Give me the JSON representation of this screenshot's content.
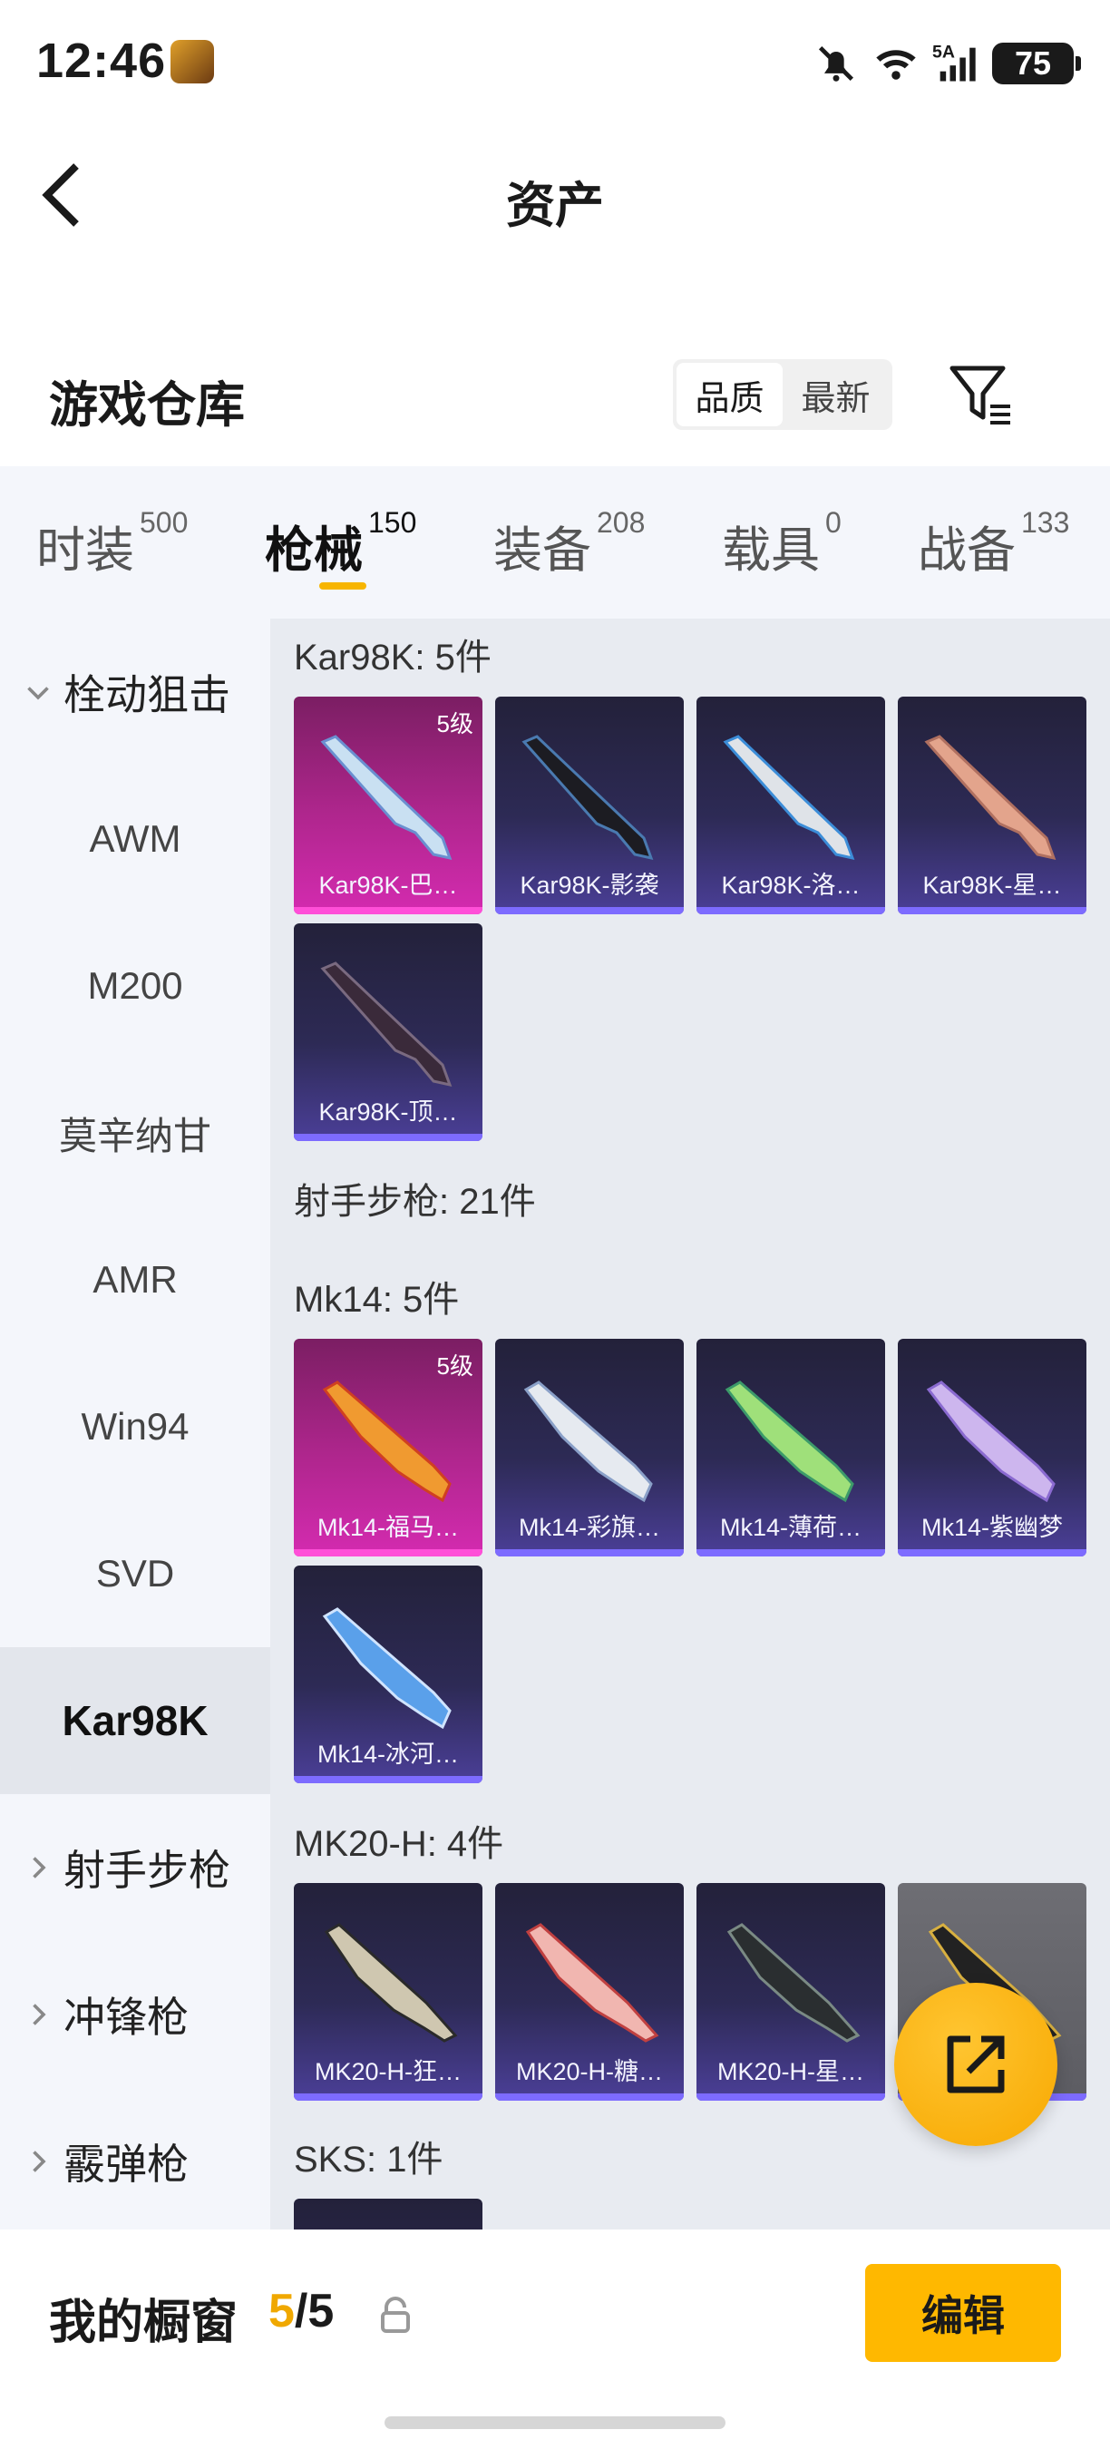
{
  "status_bar": {
    "time": "12:46",
    "network": "5A",
    "battery": "75"
  },
  "header": {
    "title": "资产"
  },
  "warehouse": {
    "title": "游戏仓库",
    "sort_options": [
      {
        "label": "品质",
        "active": true
      },
      {
        "label": "最新",
        "active": false
      }
    ]
  },
  "tabs": [
    {
      "label": "时装",
      "count": "500",
      "active": false
    },
    {
      "label": "枪械",
      "count": "150",
      "active": true
    },
    {
      "label": "装备",
      "count": "208",
      "active": false
    },
    {
      "label": "载具",
      "count": "0",
      "active": false
    },
    {
      "label": "战备",
      "count": "133",
      "active": false
    }
  ],
  "sidebar": {
    "groups": [
      {
        "label": "栓动狙击",
        "expanded": true
      },
      {
        "label": "射手步枪",
        "expanded": false
      },
      {
        "label": "冲锋枪",
        "expanded": false
      },
      {
        "label": "霰弹枪",
        "expanded": false
      }
    ],
    "items": [
      "AWM",
      "M200",
      "莫辛纳甘",
      "AMR",
      "Win94",
      "SVD",
      "Kar98K"
    ],
    "selected": "Kar98K"
  },
  "content": {
    "sections": [
      {
        "label": "Kar98K: 5件",
        "cards": [
          {
            "name": "Kar98K-巴…",
            "level": "5级",
            "rarity": "gold"
          },
          {
            "name": "Kar98K-影袭",
            "rarity": "purple"
          },
          {
            "name": "Kar98K-洛…",
            "rarity": "purple"
          },
          {
            "name": "Kar98K-星…",
            "rarity": "purple"
          },
          {
            "name": "Kar98K-顶…",
            "rarity": "purple"
          }
        ]
      },
      {
        "label": "射手步枪: 21件",
        "cards": []
      },
      {
        "label": "Mk14: 5件",
        "cards": [
          {
            "name": "Mk14-福马…",
            "level": "5级",
            "rarity": "gold"
          },
          {
            "name": "Mk14-彩旗…",
            "rarity": "purple"
          },
          {
            "name": "Mk14-薄荷…",
            "rarity": "purple"
          },
          {
            "name": "Mk14-紫幽梦",
            "rarity": "purple"
          },
          {
            "name": "Mk14-冰河…",
            "rarity": "purple"
          }
        ]
      },
      {
        "label": "MK20-H: 4件",
        "cards": [
          {
            "name": "MK20-H-狂…",
            "rarity": "purple"
          },
          {
            "name": "MK20-H-糖…",
            "rarity": "purple"
          },
          {
            "name": "MK20-H-星…",
            "rarity": "purple"
          },
          {
            "name": "…",
            "rarity": "grey"
          }
        ]
      },
      {
        "label": "SKS: 1件",
        "cards": []
      }
    ]
  },
  "bottom": {
    "showcase_label": "我的橱窗",
    "showcase_current": "5",
    "showcase_total": "/5",
    "edit_label": "编辑"
  },
  "colors": {
    "accent": "#f7b500",
    "gold_card": "#d42bb0",
    "purple_card": "#4b3f98"
  }
}
